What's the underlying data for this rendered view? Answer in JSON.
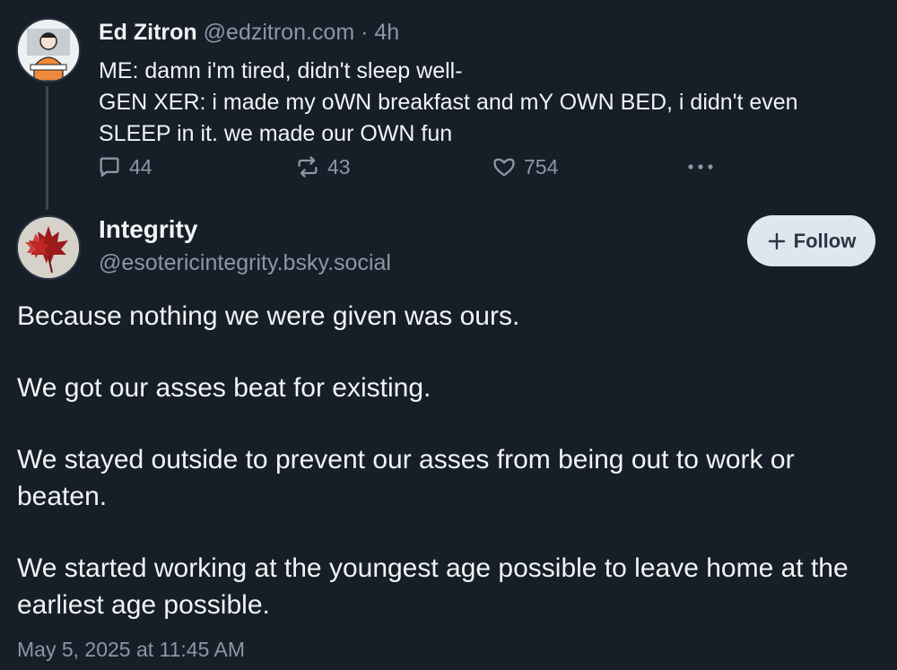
{
  "parent_post": {
    "author_name": "Ed Zitron",
    "author_handle": "@edzitron.com",
    "separator": "·",
    "age": "4h",
    "text_lines": [
      "ME: damn i'm tired, didn't sleep well-",
      "GEN XER: i made my oWN breakfast and mY OWN BED, i didn't even",
      "SLEEP in it. we made our OWN fun"
    ],
    "actions": {
      "replies": "44",
      "reposts": "43",
      "likes": "754"
    }
  },
  "main_post": {
    "author_name": "Integrity",
    "author_handle": "@esotericintegrity.bsky.social",
    "follow_label": "Follow",
    "paragraphs": [
      "Because nothing we were given was ours.",
      "We got our asses beat for existing.",
      "We stayed outside to prevent our asses from being out to work or beaten.",
      "We started working at the youngest age possible to leave home at the earliest age possible."
    ],
    "timestamp": "May 5, 2025 at 11:45 AM"
  },
  "icons": {
    "reply": "speech-bubble-icon",
    "repost": "repost-arrows-icon",
    "like": "heart-icon",
    "more": "ellipsis-icon",
    "follow": "plus-icon"
  },
  "colors": {
    "background": "#161e27",
    "text": "#f1f3f5",
    "muted": "#8b97a6",
    "follow_button": "#dfe6ee"
  }
}
